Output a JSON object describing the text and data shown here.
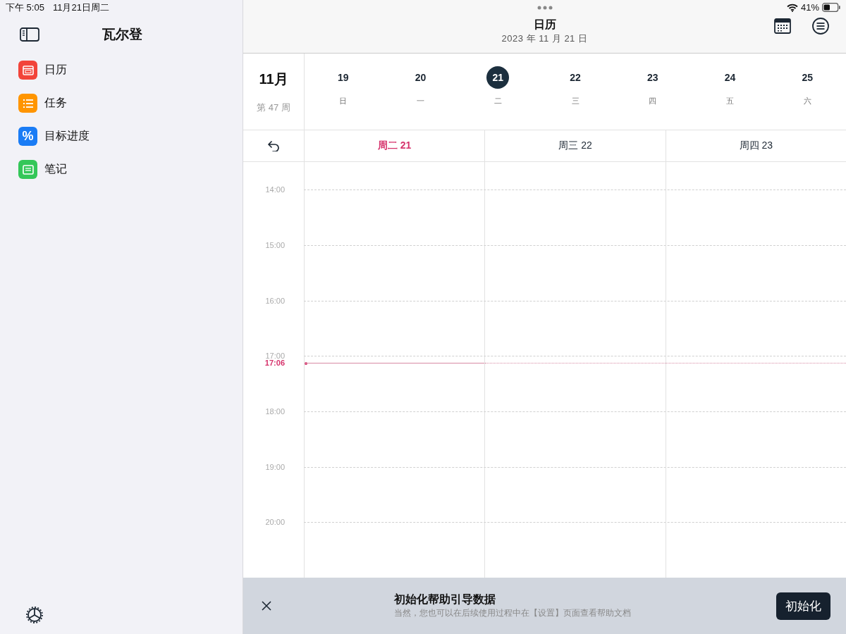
{
  "status_bar": {
    "time": "下午 5:05",
    "date": "11月21日周二",
    "battery": "41%"
  },
  "sidebar": {
    "title": "瓦尔登",
    "items": [
      {
        "label": "日历",
        "kind": "calendar",
        "color": "#f2443a"
      },
      {
        "label": "任务",
        "kind": "list",
        "color": "#ff9500"
      },
      {
        "label": "目标进度",
        "kind": "percent",
        "glyph": "%",
        "color": "#1a7cf5"
      },
      {
        "label": "笔记",
        "kind": "note",
        "color": "#34c759"
      }
    ]
  },
  "header": {
    "title": "日历",
    "subtitle": "2023 年 11 月 21 日"
  },
  "week": {
    "month": "11月",
    "week_label": "第 47 周",
    "days": [
      {
        "number": "19",
        "weekday": "日",
        "selected": false
      },
      {
        "number": "20",
        "weekday": "一",
        "selected": false
      },
      {
        "number": "21",
        "weekday": "二",
        "selected": true
      },
      {
        "number": "22",
        "weekday": "三",
        "selected": false
      },
      {
        "number": "23",
        "weekday": "四",
        "selected": false
      },
      {
        "number": "24",
        "weekday": "五",
        "selected": false
      },
      {
        "number": "25",
        "weekday": "六",
        "selected": false
      }
    ]
  },
  "columns": [
    {
      "label": "周二 21",
      "today": true
    },
    {
      "label": "周三 22",
      "today": false
    },
    {
      "label": "周四 23",
      "today": false
    }
  ],
  "hours": [
    {
      "label": "14:00"
    },
    {
      "label": "15:00"
    },
    {
      "label": "16:00"
    },
    {
      "label": "17:00",
      "now": "17:06"
    },
    {
      "label": "18:00"
    },
    {
      "label": "19:00"
    },
    {
      "label": "20:00"
    }
  ],
  "banner": {
    "title": "初始化帮助引导数据",
    "subtitle": "当然，您也可以在后续使用过程中在【设置】页面查看帮助文档",
    "button": "初始化"
  }
}
